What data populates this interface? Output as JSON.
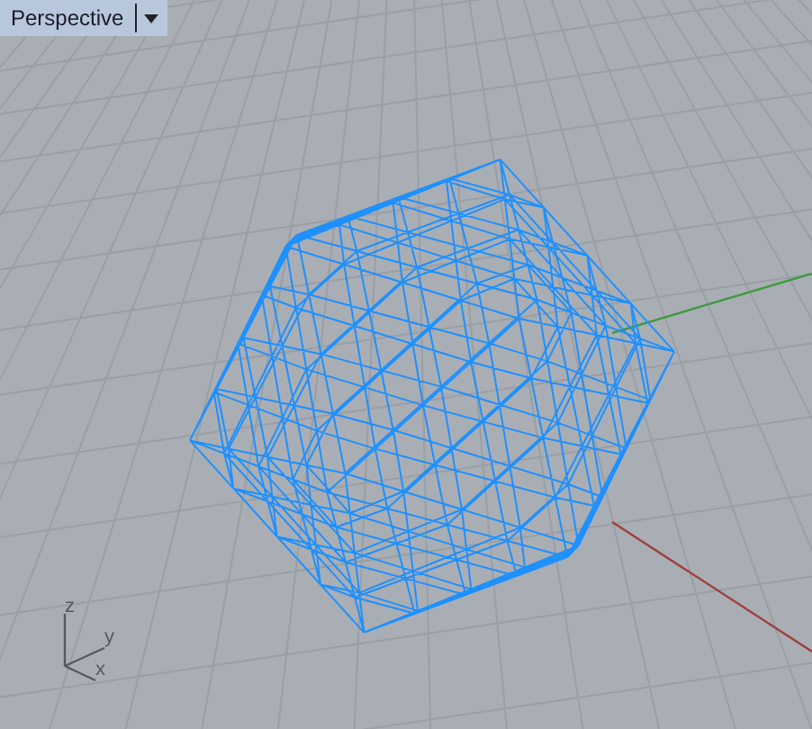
{
  "viewport": {
    "title": "Perspective",
    "axis_labels": [
      {
        "kind": "z",
        "label": "z"
      },
      {
        "kind": "y",
        "label": "y"
      },
      {
        "kind": "x",
        "label": "x"
      }
    ]
  }
}
